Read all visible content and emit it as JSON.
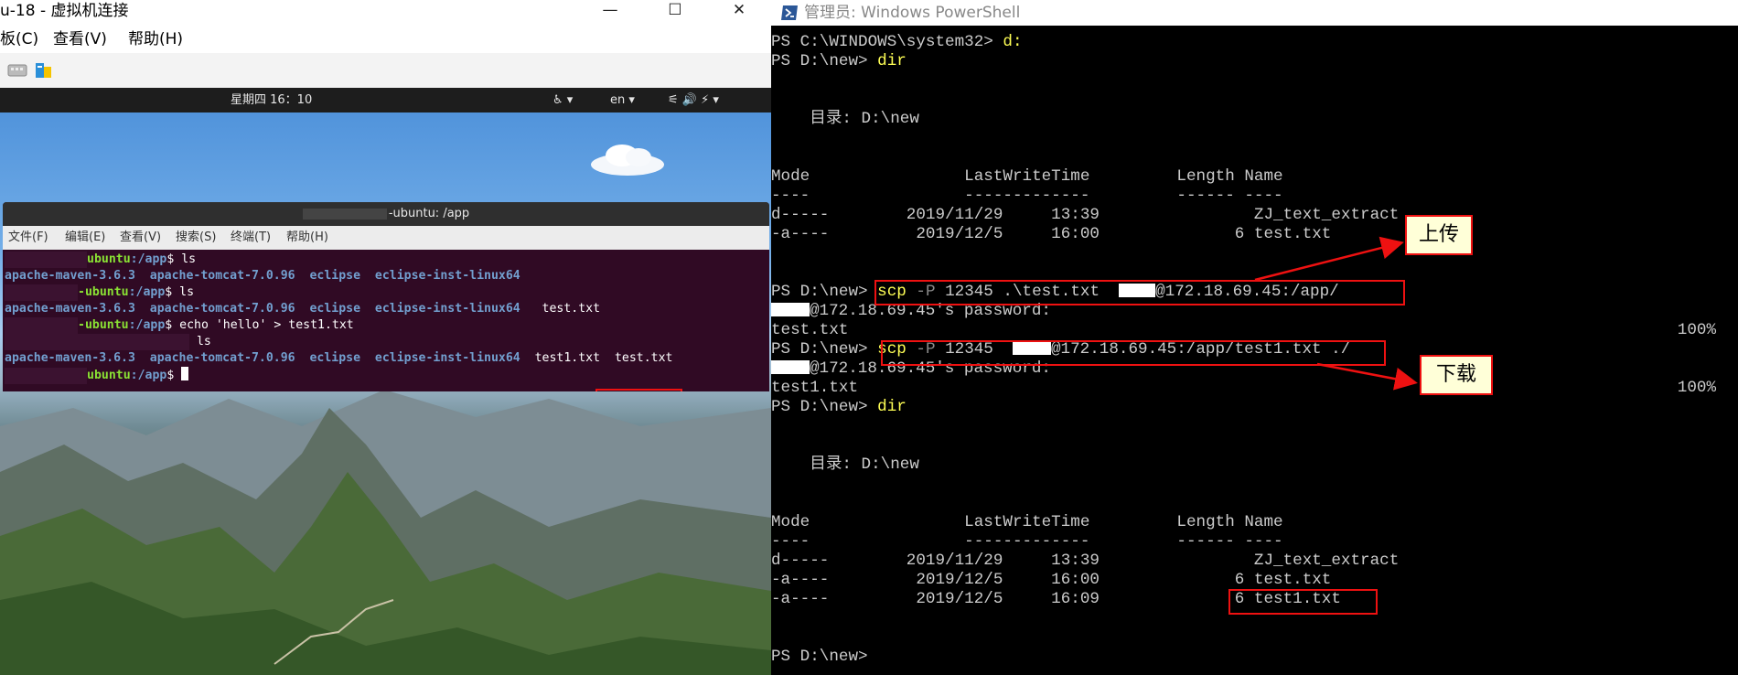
{
  "vm": {
    "title": "u-18 - 虚拟机连接",
    "menu": [
      "板(C)",
      "查看(V)",
      "帮助(H)"
    ],
    "window_buttons": [
      "—",
      "☐",
      "✕"
    ]
  },
  "guest": {
    "topbar": {
      "clock": "星期四 16：10",
      "lang": "en ▾",
      "accessibility": "♿ ▾",
      "status_icons": "⚟ 🔊 ⚡ ▾"
    },
    "terminal": {
      "title": "-ubuntu: /app",
      "menu": [
        "文件(F)",
        "编辑(E)",
        "查看(V)",
        "搜索(S)",
        "终端(T)",
        "帮助(H)"
      ],
      "lines": [
        {
          "user": "ubuntu",
          "path": ":/app",
          "cmd": "$ ls"
        },
        {
          "out": "apache-maven-3.6.3  apache-tomcat-7.0.96  eclipse  eclipse-inst-linux64"
        },
        {
          "user": "-ubuntu",
          "path": ":/app",
          "cmd": "$ ls"
        },
        {
          "out": "apache-maven-3.6.3  apache-tomcat-7.0.96  eclipse  eclipse-inst-linux64",
          "extra": "test.txt"
        },
        {
          "user": "-ubuntu",
          "path": ":/app",
          "cmd": "$ echo 'hello' > test1.txt"
        },
        {
          "user": "",
          "path": "",
          "cmd": " ls"
        },
        {
          "out": "apache-maven-3.6.3  apache-tomcat-7.0.96  eclipse  eclipse-inst-linux64",
          "extra": "test1.txt",
          "extra2": "test.txt"
        },
        {
          "user": "ubuntu",
          "path": ":/app",
          "cmd": "$ "
        }
      ]
    }
  },
  "powershell": {
    "title": "管理员: Windows PowerShell",
    "lines": [
      {
        "text": "PS C:\\WINDOWS\\system32> ",
        "y": "d:"
      },
      {
        "text": "PS D:\\new> ",
        "y": "dir"
      },
      {
        "text": ""
      },
      {
        "text": ""
      },
      {
        "text": "    目录: D:\\new"
      },
      {
        "text": ""
      },
      {
        "text": ""
      },
      {
        "text": "Mode                LastWriteTime         Length Name"
      },
      {
        "text": "----                -------------         ------ ----"
      },
      {
        "text": "d-----        2019/11/29     13:39                ZJ_text_extract"
      },
      {
        "text": "-a----         2019/12/5     16:00              6 test.txt"
      },
      {
        "text": ""
      },
      {
        "text": ""
      },
      {
        "text": "PS D:\\new> ",
        "y": "scp",
        "g": " -P",
        "rest": " 12345 .\\test.txt  ",
        "after": "@172.18.69.45:/app/"
      },
      {
        "text": "",
        "after": "@172.18.69.45's password:"
      },
      {
        "text": "test.txt",
        "pct": "100%"
      },
      {
        "text": "PS D:\\new> ",
        "y": "scp",
        "g": " -P",
        "rest": " 12345  ",
        "after": "@172.18.69.45:/app/test1.txt ./"
      },
      {
        "text": "",
        "after": "@172.18.69.45's password:"
      },
      {
        "text": "test1.txt",
        "pct": "100%"
      },
      {
        "text": "PS D:\\new> ",
        "y": "dir"
      },
      {
        "text": ""
      },
      {
        "text": ""
      },
      {
        "text": "    目录: D:\\new"
      },
      {
        "text": ""
      },
      {
        "text": ""
      },
      {
        "text": "Mode                LastWriteTime         Length Name"
      },
      {
        "text": "----                -------------         ------ ----"
      },
      {
        "text": "d-----        2019/11/29     13:39                ZJ_text_extract"
      },
      {
        "text": "-a----         2019/12/5     16:00              6 test.txt"
      },
      {
        "text": "-a----         2019/12/5     16:09              6 test1.txt"
      },
      {
        "text": ""
      },
      {
        "text": ""
      },
      {
        "text": "PS D:\\new>"
      }
    ]
  },
  "annotations": {
    "upload_label": "上传",
    "download_label": "下载",
    "color": "#e11111"
  }
}
